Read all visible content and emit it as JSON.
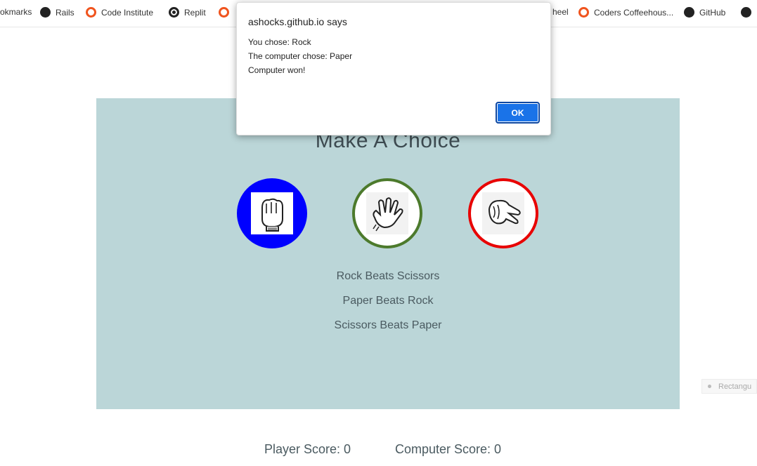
{
  "bookmarks": [
    {
      "label": "okmarks",
      "icon": "bookmarks-folder-icon"
    },
    {
      "label": "Rails",
      "icon": "rails-icon"
    },
    {
      "label": "Code Institute",
      "icon": "code-institute-icon"
    },
    {
      "label": "Replit",
      "icon": "replit-icon"
    },
    {
      "label": "",
      "icon": "bookmark-icon"
    },
    {
      "label": "heel",
      "icon": ""
    },
    {
      "label": "Coders Coffeehous...",
      "icon": "coders-coffeehouse-icon"
    },
    {
      "label": "GitHub",
      "icon": "github-icon"
    },
    {
      "label": "",
      "icon": "github-icon"
    }
  ],
  "game": {
    "title": "Make A Choice",
    "choices": [
      {
        "name": "Rock",
        "icon": "rock-hand-icon",
        "color": "#0000ff"
      },
      {
        "name": "Paper",
        "icon": "paper-hand-icon",
        "color": "#4c7a2c"
      },
      {
        "name": "Scissors",
        "icon": "scissors-hand-icon",
        "color": "#e80000"
      }
    ],
    "rules": [
      "Rock Beats Scissors",
      "Paper Beats Rock",
      "Scissors Beats Paper"
    ],
    "panel_color": "#bbd6d8"
  },
  "score": {
    "player": "Player Score: 0",
    "computer": "Computer Score: 0"
  },
  "side_tab": {
    "label": "Rectangu"
  },
  "alert": {
    "title": "ashocks.github.io says",
    "lines": [
      "You chose: Rock",
      "The computer chose: Paper",
      "Computer won!"
    ],
    "ok_label": "OK"
  }
}
